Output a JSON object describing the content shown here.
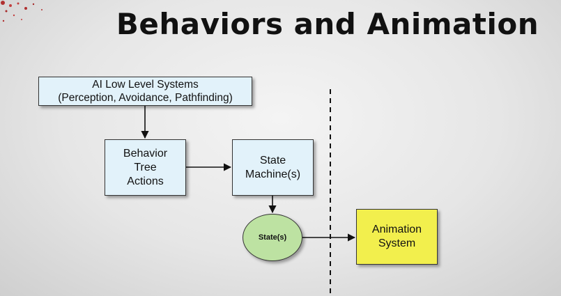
{
  "slide": {
    "title": "Behaviors and Animation"
  },
  "diagram": {
    "nodes": {
      "ai_low_level": "AI Low Level Systems\n(Perception, Avoidance, Pathfinding)",
      "behavior_tree": "Behavior\nTree\nActions",
      "state_machine": "State\nMachine(s)",
      "states": "State(s)",
      "animation": "Animation\nSystem"
    },
    "colors": {
      "box_fill": "#e2f2fa",
      "ellipse_fill": "#bde2a2",
      "animation_fill": "#f2ef4d"
    }
  }
}
